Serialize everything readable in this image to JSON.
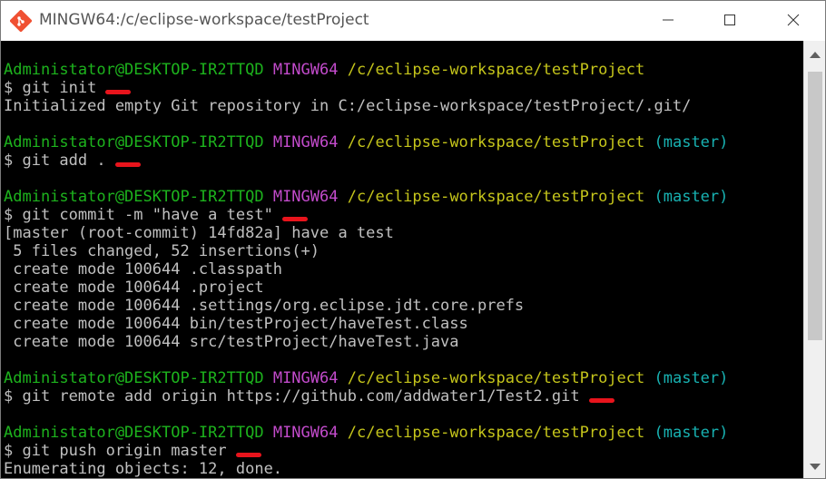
{
  "window": {
    "title": "MINGW64:/c/eclipse-workspace/testProject",
    "icon": "git-bash-icon"
  },
  "controls": {
    "minimize": "minimize-icon",
    "maximize": "maximize-icon",
    "close": "close-icon"
  },
  "terminal": {
    "prompt": {
      "user": "Administator@DESKTOP-IR2TTQD",
      "shell": "MINGW64",
      "path": "/c/eclipse-workspace/testProject",
      "branch": "(master)"
    },
    "blocks": [
      {
        "has_branch": false,
        "command": "$ git init",
        "output": [
          "Initialized empty Git repository in C:/eclipse-workspace/testProject/.git/"
        ]
      },
      {
        "has_branch": true,
        "command": "$ git add .",
        "output": []
      },
      {
        "has_branch": true,
        "command": "$ git commit -m \"have a test\"",
        "output": [
          "[master (root-commit) 14fd82a] have a test",
          " 5 files changed, 52 insertions(+)",
          " create mode 100644 .classpath",
          " create mode 100644 .project",
          " create mode 100644 .settings/org.eclipse.jdt.core.prefs",
          " create mode 100644 bin/testProject/haveTest.class",
          " create mode 100644 src/testProject/haveTest.java"
        ]
      },
      {
        "has_branch": true,
        "command": "$ git remote add origin https://github.com/addwater1/Test2.git",
        "output": []
      },
      {
        "has_branch": true,
        "command": "$ git push origin master",
        "output": [
          "Enumerating objects: 12, done."
        ]
      }
    ]
  },
  "colors": {
    "user": "#1db31d",
    "shell": "#c24bcb",
    "path": "#c5c51b",
    "branch": "#18b2b2",
    "text": "#c0c0c0",
    "mark": "#e8141c",
    "background": "#000000"
  }
}
